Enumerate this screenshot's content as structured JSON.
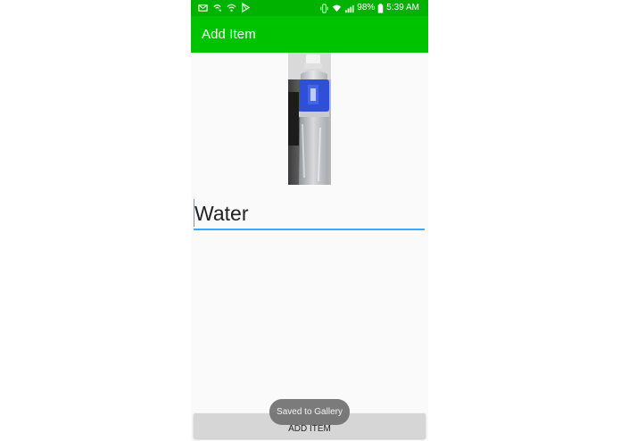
{
  "status_bar": {
    "left_icons": [
      "mail-icon",
      "wifi-call-icon",
      "wifi-icon",
      "play-store-icon"
    ],
    "right_icons": [
      "vibrate-icon",
      "wifi-icon",
      "signal-icon",
      "battery-icon"
    ],
    "battery": "98%",
    "time": "5:39 AM"
  },
  "app_bar": {
    "title": "Add Item",
    "color": "#00c300"
  },
  "item_photo": {
    "description_icon": "water-bottle-photo"
  },
  "form": {
    "name_value": "Water"
  },
  "actions": {
    "add_item_label": "ADD ITEM"
  },
  "toast": {
    "message": "Saved to Gallery"
  },
  "colors": {
    "status_bar": "#00b200",
    "accent": "#3ea8ff",
    "background": "#fafafa",
    "button": "#d6d6d6"
  }
}
